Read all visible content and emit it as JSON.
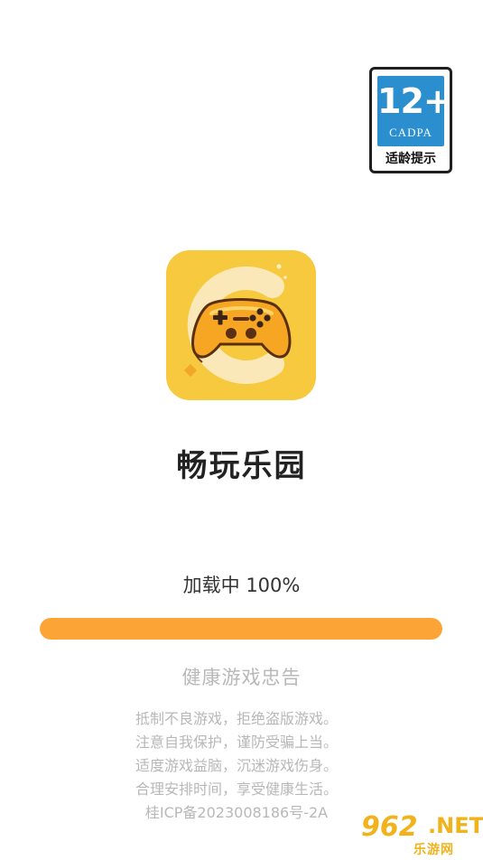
{
  "rating_badge": {
    "age": "12+",
    "org": "CADPA",
    "tip": "适龄提示"
  },
  "app": {
    "icon": "gamepad-icon",
    "name": "畅玩乐园"
  },
  "loading": {
    "text": "加载中 100%",
    "progress": 1.0
  },
  "advisory": {
    "title": "健康游戏忠告",
    "lines": [
      "抵制不良游戏，拒绝盗版游戏。",
      "注意自我保护，谨防受骗上当。",
      "适度游戏益脑，沉迷游戏伤身。",
      "合理安排时间，享受健康生活。",
      "桂ICP备2023008186号-2A"
    ]
  },
  "watermark": {
    "brand": "962",
    "suffix": ".NET",
    "sub": "乐游网"
  },
  "colors": {
    "accent": "#fca436",
    "badge_blue": "#2b8fcf",
    "icon_bg": "#f7c93e",
    "muted_text": "#b8b8b8"
  }
}
